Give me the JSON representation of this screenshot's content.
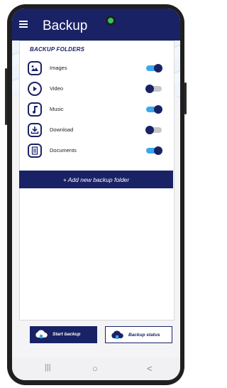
{
  "header": {
    "title": "Backup"
  },
  "section": {
    "title": "BACKUP FOLDERS"
  },
  "folders": [
    {
      "label": "Images",
      "enabled": true,
      "icon": "image-icon"
    },
    {
      "label": "Video",
      "enabled": false,
      "icon": "play-icon"
    },
    {
      "label": "Music",
      "enabled": true,
      "icon": "music-note-icon"
    },
    {
      "label": "Download",
      "enabled": false,
      "icon": "download-icon"
    },
    {
      "label": "Documents",
      "enabled": true,
      "icon": "document-icon"
    }
  ],
  "actions": {
    "add_folder": "+ Add new backup folder",
    "start_backup": "Start backup",
    "backup_status": "Backup status"
  },
  "nav": {
    "recents": "|||",
    "home": "○",
    "back": "<"
  },
  "colors": {
    "brand": "#1a2266",
    "toggle_on": "#39a9ea",
    "toggle_off": "#c7c7c7",
    "camera": "#35c16a"
  }
}
